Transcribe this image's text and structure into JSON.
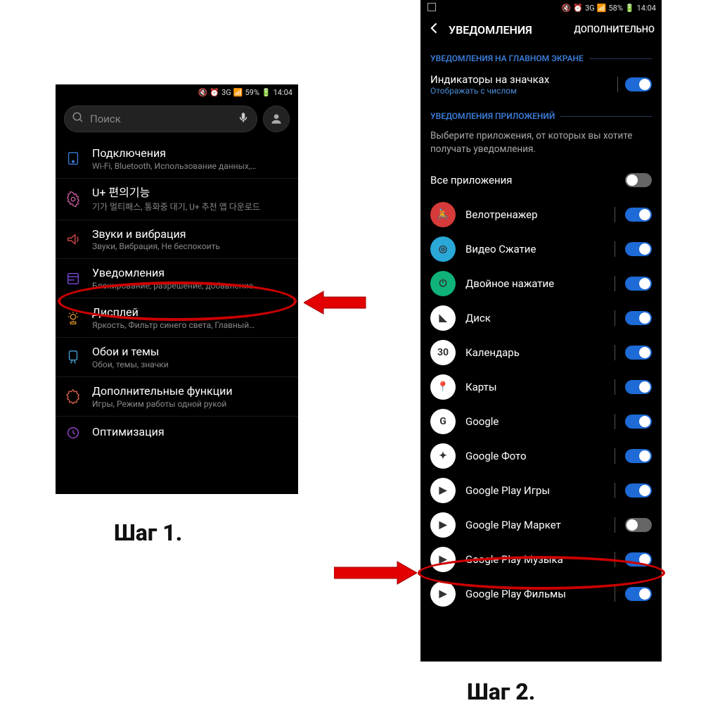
{
  "labels": {
    "step1": "Шаг 1.",
    "step2": "Шаг 2."
  },
  "phone1": {
    "status": {
      "battery": "59%",
      "time": "14:04",
      "net": "3G"
    },
    "search": {
      "placeholder": "Поиск"
    },
    "items": [
      {
        "title": "Подключения",
        "sub": "Wi-Fi, Bluetooth, Использование данных,…"
      },
      {
        "title": "U+ 편의기능",
        "sub": "기가 멀티패스, 통화중 대기, U+ 추천 앱 다운로드"
      },
      {
        "title": "Звуки и вибрация",
        "sub": "Звуки, Вибрация, Не беспокоить"
      },
      {
        "title": "Уведомления",
        "sub": "Блокирование, разрешение, добавление…"
      },
      {
        "title": "Дисплей",
        "sub": "Яркость, Фильтр синего света, Главный…"
      },
      {
        "title": "Обои и темы",
        "sub": "Обои, темы, значки"
      },
      {
        "title": "Дополнительные функции",
        "sub": "Игры, Режим работы одной рукой"
      },
      {
        "title": "Оптимизация",
        "sub": ""
      }
    ]
  },
  "phone2": {
    "status": {
      "battery": "58%",
      "time": "14:04",
      "net": "3G"
    },
    "header": {
      "title": "УВЕДОМЛЕНИЯ",
      "right": "ДОПОЛНИТЕЛЬНО"
    },
    "section1": "УВЕДОМЛЕНИЯ НА ГЛАВНОМ ЭКРАНЕ",
    "badges": {
      "title": "Индикаторы на значках",
      "sub": "Отображать с числом",
      "on": true
    },
    "section2": "УВЕДОМЛЕНИЯ ПРИЛОЖЕНИЙ",
    "desc": "Выберите приложения, от которых вы хотите получать уведомления.",
    "all": {
      "label": "Все приложения",
      "on": false
    },
    "apps": [
      {
        "label": "Велотренажер",
        "on": true,
        "bg": "#d63a3a",
        "glyph": "🚴"
      },
      {
        "label": "Видео Сжатие",
        "on": true,
        "bg": "#2aa8d8",
        "glyph": "◎"
      },
      {
        "label": "Двойное нажатие",
        "on": true,
        "bg": "#0fb37a",
        "glyph": "⏻"
      },
      {
        "label": "Диск",
        "on": true,
        "bg": "#fff",
        "glyph": "◣"
      },
      {
        "label": "Календарь",
        "on": true,
        "bg": "#fff",
        "glyph": "30"
      },
      {
        "label": "Карты",
        "on": true,
        "bg": "#fff",
        "glyph": "📍"
      },
      {
        "label": "Google",
        "on": true,
        "bg": "#fff",
        "glyph": "G"
      },
      {
        "label": "Google Фото",
        "on": true,
        "bg": "#fff",
        "glyph": "✦"
      },
      {
        "label": "Google Play Игры",
        "on": true,
        "bg": "#fff",
        "glyph": "▶"
      },
      {
        "label": "Google Play Маркет",
        "on": false,
        "bg": "#fff",
        "glyph": "▶"
      },
      {
        "label": "Google Play Музыка",
        "on": true,
        "bg": "#fff",
        "glyph": "▶"
      },
      {
        "label": "Google Play Фильмы",
        "on": true,
        "bg": "#fff",
        "glyph": "▶"
      }
    ]
  }
}
